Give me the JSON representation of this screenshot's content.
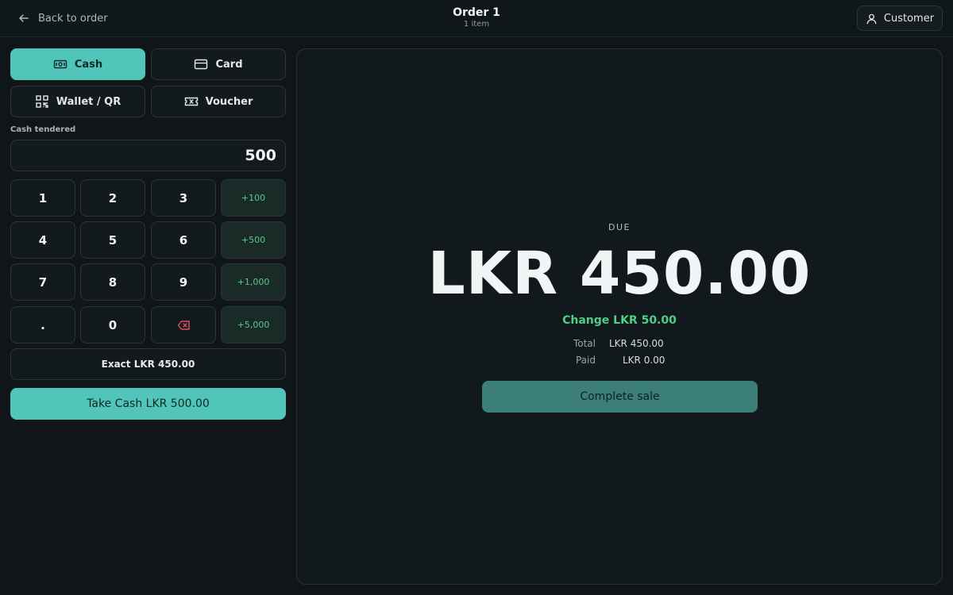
{
  "header": {
    "back_label": "Back to order",
    "title": "Order 1",
    "subtitle": "1 item",
    "customer_label": "Customer"
  },
  "payment_methods": [
    {
      "label": "Cash",
      "icon": "banknote-icon",
      "active": true
    },
    {
      "label": "Card",
      "icon": "credit-card-icon",
      "active": false
    },
    {
      "label": "Wallet / QR",
      "icon": "qr-code-icon",
      "active": false
    },
    {
      "label": "Voucher",
      "icon": "ticket-icon",
      "active": false
    }
  ],
  "cash": {
    "tendered_label": "Cash tendered",
    "tendered_value": "500"
  },
  "keypad": {
    "keys": [
      "1",
      "2",
      "3",
      "4",
      "5",
      "6",
      "7",
      "8",
      "9",
      ".",
      "0"
    ],
    "backspace_icon": "backspace-icon",
    "quick_amounts": [
      "+100",
      "+500",
      "+1,000",
      "+5,000"
    ]
  },
  "actions": {
    "exact_label": "Exact LKR 450.00",
    "take_cash_label": "Take Cash LKR 500.00",
    "complete_label": "Complete sale"
  },
  "summary": {
    "due_label": "DUE",
    "due_amount": "LKR 450.00",
    "change_text": "Change LKR 50.00",
    "total_label": "Total",
    "total_value": "LKR 450.00",
    "paid_label": "Paid",
    "paid_value": "LKR 0.00"
  },
  "colors": {
    "accent": "#52c5ba",
    "positive": "#4fcf86",
    "background": "#0f1518",
    "danger": "#e0525e"
  }
}
